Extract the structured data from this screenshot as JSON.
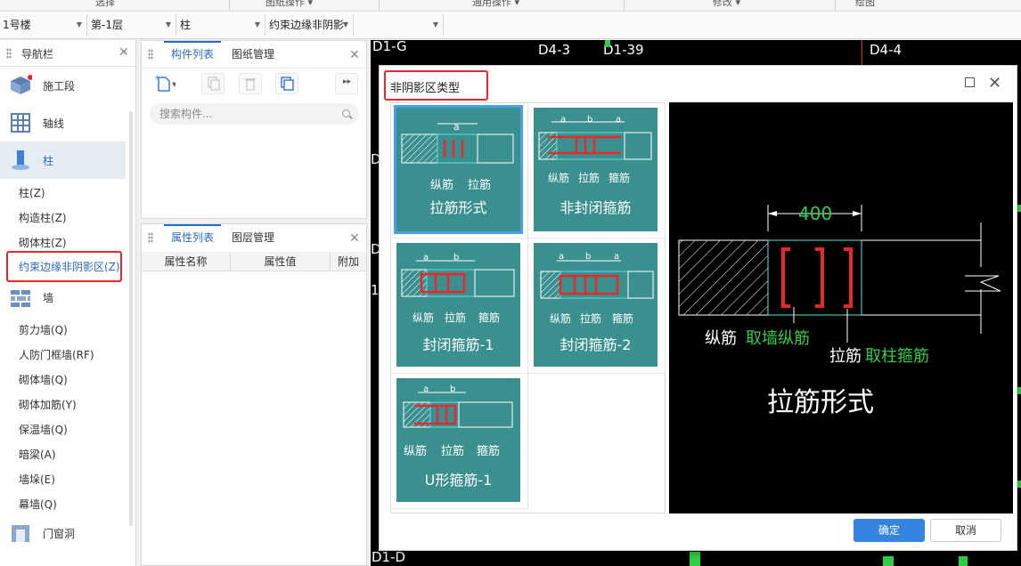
{
  "ribbon": {
    "groups": [
      "选择",
      "图纸操作 ▾",
      "通用操作 ▾",
      "修改 ▾",
      "绘图"
    ]
  },
  "selectors": [
    "1号楼",
    "第-1层",
    "柱",
    "约束边缘非阴影",
    ""
  ],
  "nav": {
    "title": "导航栏",
    "categories": [
      {
        "label": "施工段",
        "icon": "layer-icon"
      },
      {
        "label": "轴线",
        "icon": "grid-icon"
      },
      {
        "label": "柱",
        "icon": "column-icon"
      },
      {
        "label": "墙",
        "icon": "wall-icon"
      },
      {
        "label": "门窗洞",
        "icon": "door-icon"
      }
    ],
    "column_items": [
      "柱(Z)",
      "构造柱(Z)",
      "砌体柱(Z)",
      "约束边缘非阴影区(Z)"
    ],
    "wall_items": [
      "剪力墙(Q)",
      "人防门框墙(RF)",
      "砌体墙(Q)",
      "砌体加筋(Y)",
      "保温墙(Q)",
      "暗梁(A)",
      "墙垛(E)",
      "幕墙(Q)"
    ]
  },
  "component_list": {
    "tabs": [
      "构件列表",
      "图纸管理"
    ],
    "search_placeholder": "搜索构件..."
  },
  "property_list": {
    "tabs": [
      "属性列表",
      "图层管理"
    ],
    "columns": [
      "属性名称",
      "属性值",
      "附加"
    ]
  },
  "canvas": {
    "labels": [
      "D1-G",
      "D4-3",
      "D1-39",
      "D4-4",
      "D1-D",
      "D",
      "D",
      "1"
    ]
  },
  "dialog": {
    "title": "非阴影区类型",
    "types": [
      {
        "caption": "拉筋形式",
        "labels": [
          "a",
          "纵筋",
          "拉筋"
        ]
      },
      {
        "caption": "非封闭箍筋",
        "labels": [
          "a",
          "b",
          "a",
          "纵筋",
          "拉筋",
          "箍筋"
        ]
      },
      {
        "caption": "封闭箍筋-1",
        "labels": [
          "a",
          "b",
          "纵筋",
          "拉筋",
          "箍筋"
        ]
      },
      {
        "caption": "封闭箍筋-2",
        "labels": [
          "a",
          "b",
          "a",
          "纵筋",
          "拉筋",
          "箍筋"
        ]
      },
      {
        "caption": "U形箍筋-1",
        "labels": [
          "a",
          "b",
          "纵筋",
          "拉筋",
          "箍筋"
        ]
      }
    ],
    "preview": {
      "dimension": "400",
      "label1_white": "纵筋",
      "label1_green": "取墙纵筋",
      "label2_white": "拉筋",
      "label2_green": "取柱箍筋",
      "title": "拉筋形式"
    },
    "ok_label": "确定",
    "cancel_label": "取消"
  },
  "colors": {
    "accent": "#2a6bc2",
    "card": "#3a908e",
    "highlight_box": "#e8282d",
    "cad_green": "#2dcf44",
    "rebar_red": "#e8282d"
  }
}
